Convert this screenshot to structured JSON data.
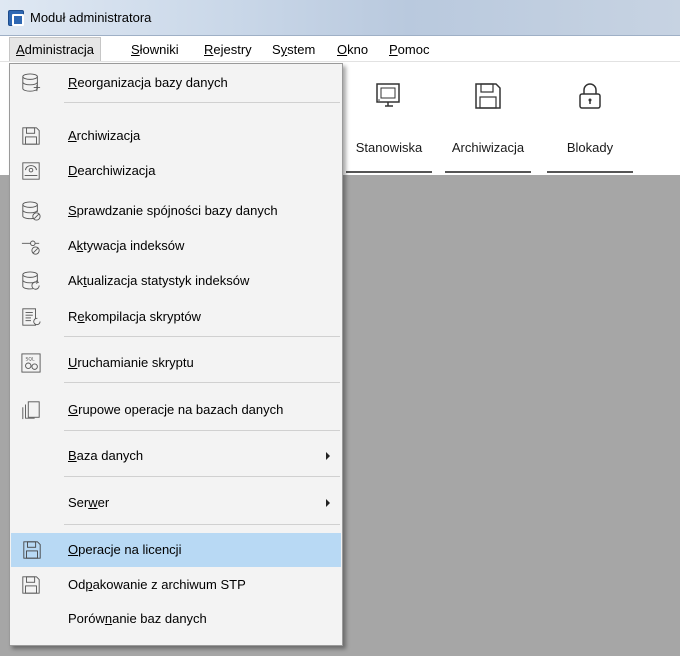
{
  "window": {
    "title": "Moduł administratora"
  },
  "menubar": [
    {
      "label": "Administracja",
      "accel": "A"
    },
    {
      "label": "Słowniki",
      "accel": "S"
    },
    {
      "label": "Rejestry",
      "accel": "R"
    },
    {
      "label": "System",
      "accel": "y"
    },
    {
      "label": "Okno",
      "accel": "O"
    },
    {
      "label": "Pomoc",
      "accel": "P"
    }
  ],
  "toolbar": [
    {
      "label": "Stanowiska",
      "icon": "monitor-icon"
    },
    {
      "label": "Archiwizacja",
      "icon": "floppy-disk-icon"
    },
    {
      "label": "Blokady",
      "icon": "padlock-icon"
    }
  ],
  "menu_items": [
    {
      "label": "Reorganizacja bazy danych",
      "icon": "database-reorganize-icon"
    },
    {
      "label": "Archiwizacja",
      "icon": "floppy-disk-icon"
    },
    {
      "label": "Dearchiwizacja",
      "icon": "restore-disk-icon"
    },
    {
      "label": "Sprawdzanie spójności bazy danych",
      "icon": "database-check-icon"
    },
    {
      "label": "Aktywacja indeksów",
      "icon": "index-activate-icon"
    },
    {
      "label": "Aktualizacja statystyk indeksów",
      "icon": "database-refresh-icon"
    },
    {
      "label": "Rekompilacja skryptów",
      "icon": "script-recompile-icon"
    },
    {
      "label": "Uruchamianie skryptu",
      "icon": "sql-script-icon"
    },
    {
      "label": "Grupowe operacje na bazach danych",
      "icon": "group-operations-icon"
    },
    {
      "label": "Baza danych",
      "submenu": true
    },
    {
      "label": "Serwer",
      "submenu": true
    },
    {
      "label": "Operacje na licencji",
      "icon": "floppy-disk-icon",
      "highlighted": true
    },
    {
      "label": "Odpakowanie z archiwum STP",
      "icon": "floppy-disk-icon"
    },
    {
      "label": "Porównanie baz danych"
    }
  ],
  "colors": {
    "highlight": "#b8d9f4",
    "workspace": "#a6a6a6",
    "menu_background": "#f3f3f3"
  }
}
